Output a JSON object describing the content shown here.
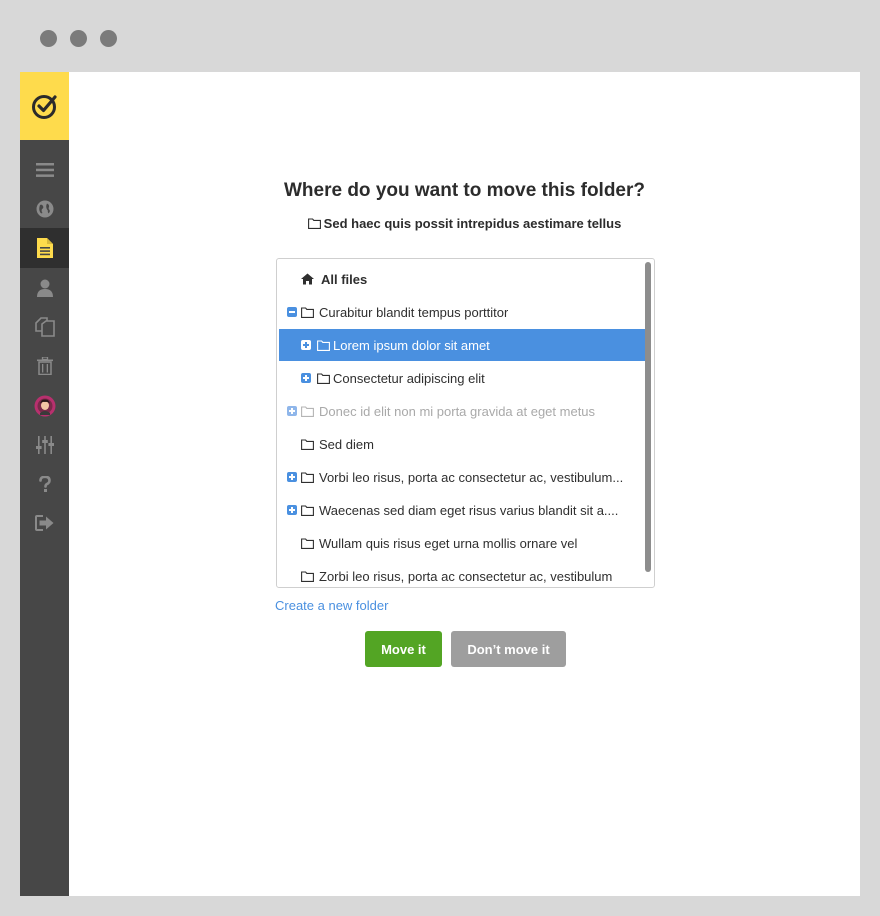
{
  "browser": {
    "controls": [
      "close",
      "minimize",
      "maximize"
    ]
  },
  "sidebar": {
    "logo_icon": "check-circle-icon",
    "items": [
      {
        "name": "menu",
        "icon": "hamburger-icon",
        "active": false
      },
      {
        "name": "globe",
        "icon": "globe-icon",
        "active": false
      },
      {
        "name": "documents",
        "icon": "document-icon",
        "active": true
      },
      {
        "name": "user",
        "icon": "user-icon",
        "active": false
      },
      {
        "name": "copies",
        "icon": "copy-icon",
        "active": false
      },
      {
        "name": "trash",
        "icon": "trash-icon",
        "active": false
      },
      {
        "name": "avatar",
        "icon": "avatar-icon",
        "active": false
      },
      {
        "name": "settings",
        "icon": "sliders-icon",
        "active": false
      },
      {
        "name": "help",
        "icon": "question-icon",
        "active": false
      },
      {
        "name": "logout",
        "icon": "sign-out-icon",
        "active": false
      }
    ]
  },
  "dialog": {
    "title": "Where do you want to move this folder?",
    "folder_name": "Sed haec quis possit intrepidus aestimare tellus",
    "tree": {
      "root_label": "All files",
      "items": [
        {
          "label": "Curabitur blandit tempus porttitor",
          "toggle": "minus",
          "state": "normal",
          "level": 0
        },
        {
          "label": "Lorem ipsum dolor sit amet",
          "toggle": "plus",
          "state": "selected",
          "level": 1
        },
        {
          "label": "Consectetur adipiscing elit",
          "toggle": "plus",
          "state": "normal",
          "level": 1
        },
        {
          "label": "Donec id elit non mi porta gravida at eget metus",
          "toggle": "plus",
          "state": "disabled",
          "level": 0
        },
        {
          "label": "Sed diem",
          "toggle": "none",
          "state": "normal",
          "level": 0
        },
        {
          "label": "Vorbi leo risus, porta ac consectetur ac, vestibulum...",
          "toggle": "plus",
          "state": "normal",
          "level": 0
        },
        {
          "label": "Waecenas sed diam eget risus varius blandit sit a....",
          "toggle": "plus",
          "state": "normal",
          "level": 0
        },
        {
          "label": "Wullam quis risus eget urna mollis ornare vel",
          "toggle": "none",
          "state": "normal",
          "level": 0
        },
        {
          "label": "Zorbi leo risus, porta ac consectetur ac, vestibulum",
          "toggle": "none",
          "state": "normal",
          "level": 0
        }
      ]
    },
    "create_link": "Create a new folder",
    "primary_button": "Move it",
    "secondary_button": "Don’t move it"
  },
  "colors": {
    "accent": "#4a90e0",
    "success": "#53a524",
    "sidebar": "#474747",
    "logo_bg": "#fedb4c"
  }
}
